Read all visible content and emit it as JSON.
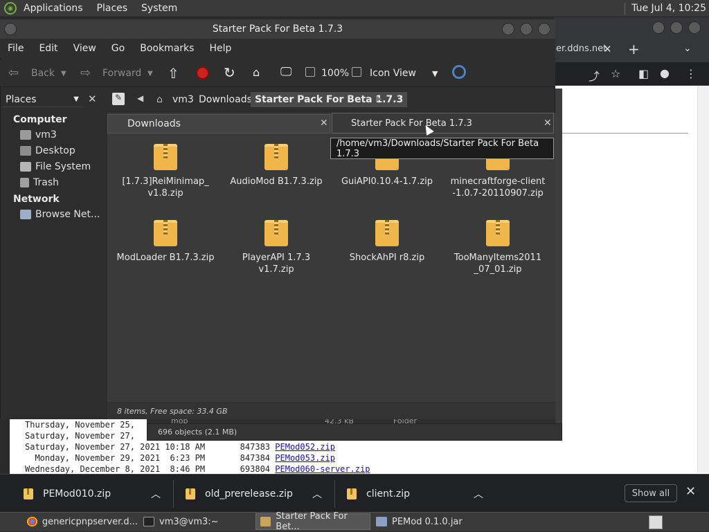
{
  "top_panel": {
    "menus": [
      "Applications",
      "Places",
      "System"
    ],
    "clock": "Tue Jul  4, 10:25"
  },
  "browser": {
    "tab_text": "er.ddns.net",
    "listing_rows": [
      {
        "date": "Thursday, November 25,",
        "size": "",
        "file": ""
      },
      {
        "date": "Saturday, November 27,",
        "size": "",
        "file": ""
      },
      {
        "date": "Saturday, November 27, 2021 10:18 AM",
        "size": "847383",
        "file": "PEMod052.zip"
      },
      {
        "date": "  Monday, November 29, 2021  6:23 PM",
        "size": "847384",
        "file": "PEMod053.zip"
      },
      {
        "date": "Wednesday, December 8, 2021  8:46 PM",
        "size": "693804",
        "file": "PEMod060-server.zip"
      }
    ]
  },
  "downloads_bar": {
    "items": [
      "PEMod010.zip",
      "old_prerelease.zip",
      "client.zip"
    ],
    "show_all": "Show all"
  },
  "taskbar": {
    "tasks": [
      "genericpnpserver.d...",
      "vm3@vm3:~",
      "Starter Pack For Bet...",
      "PEMod 0.1.0.jar"
    ]
  },
  "file_manager": {
    "title": "Starter Pack For Beta 1.7.3",
    "menu": [
      "File",
      "Edit",
      "View",
      "Go",
      "Bookmarks",
      "Help"
    ],
    "toolbar": {
      "back": "Back",
      "forward": "Forward",
      "zoom": "100%",
      "view_mode": "Icon View"
    },
    "sidebar": {
      "selector": "Places",
      "sections": [
        {
          "heading": "Computer",
          "items": [
            "vm3",
            "Desktop",
            "File System",
            "Trash"
          ]
        },
        {
          "heading": "Network",
          "items": [
            "Browse Net..."
          ]
        }
      ]
    },
    "path": [
      "vm3",
      "Downloads",
      "Starter Pack For Beta 1.7.3"
    ],
    "tabs": [
      "Downloads",
      "Starter Pack For Beta 1.7.3"
    ],
    "tooltip": "/home/vm3/Downloads/Starter Pack For Beta 1.7.3",
    "files": [
      "[1.7.3]ReiMinimap_v1.8.zip",
      "AudioMod B1.7.3.zip",
      "GuiAPI0.10.4-1.7.zip",
      "minecraftforge-client-1.0.7-20110907.zip",
      "ModLoader B1.7.3.zip",
      "PlayerAPI 1.7.3 v1.7.zip",
      "ShockAhPI r8.zip",
      "TooManyItems2011_07_01.zip"
    ],
    "status": "8 items, Free space: 33.4 GB"
  },
  "file_manager_2": {
    "ghost_row": {
      "name": "mob",
      "size": "42.3 kB",
      "type": "Folder"
    },
    "status": "696 objects (2.1 MB)"
  }
}
